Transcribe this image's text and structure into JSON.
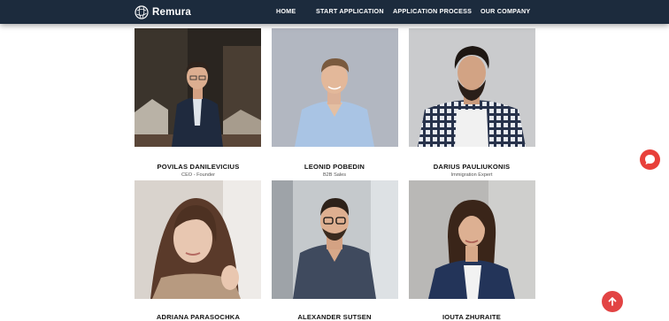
{
  "header": {
    "brand": "Remura",
    "nav": [
      "HOME",
      "START APPLICATION",
      "APPLICATION PROCESS",
      "OUR COMPANY"
    ]
  },
  "team": [
    {
      "name": "POVILAS DANILEVICIUS",
      "role": "CEO - Founder"
    },
    {
      "name": "LEONID POBEDIN",
      "role": "B2B Sales"
    },
    {
      "name": "DARIUS PAULIUKONIS",
      "role": "Immigration Expert"
    },
    {
      "name": "ADRIANA PARASOCHKA",
      "role": ""
    },
    {
      "name": "ALEXANDER SUTSEN",
      "role": ""
    },
    {
      "name": "IOUTA ZHURAITE",
      "role": ""
    }
  ],
  "icons": {
    "logo": "globe-logo-icon",
    "chat": "chat-bubble-icon",
    "scroll_top": "arrow-up-icon"
  },
  "colors": {
    "header_bg": "#1c2b3d",
    "accent": "#e8403a"
  }
}
